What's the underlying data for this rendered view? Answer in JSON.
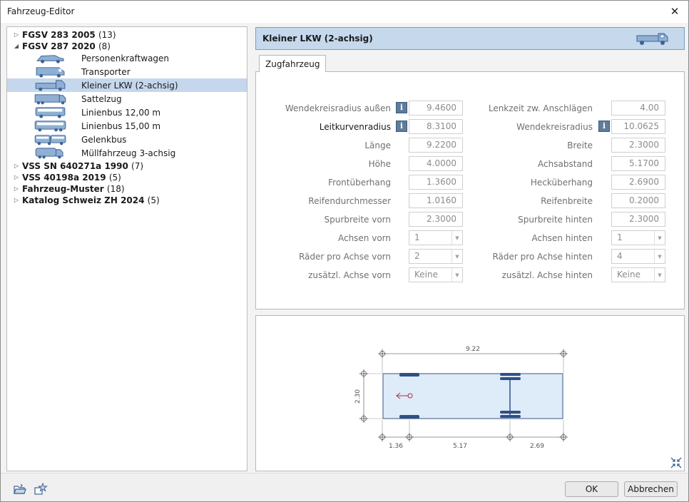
{
  "window": {
    "title": "Fahrzeug-Editor"
  },
  "tree": {
    "groups": [
      {
        "label": "FGSV 283 2005",
        "count": "(13)",
        "expanded": false
      },
      {
        "label": "FGSV 287 2020",
        "count": "(8)",
        "expanded": true
      },
      {
        "label": "VSS SN 640271a 1990",
        "count": "(7)",
        "expanded": false
      },
      {
        "label": "VSS 40198a 2019",
        "count": "(5)",
        "expanded": false
      },
      {
        "label": "Fahrzeug-Muster",
        "count": "(18)",
        "expanded": false
      },
      {
        "label": "Katalog Schweiz ZH 2024",
        "count": "(5)",
        "expanded": false
      }
    ],
    "items": [
      {
        "label": "Personenkraftwagen",
        "icon": "car-icon"
      },
      {
        "label": "Transporter",
        "icon": "van-icon"
      },
      {
        "label": "Kleiner LKW (2-achsig)",
        "icon": "truck-icon",
        "selected": true
      },
      {
        "label": "Sattelzug",
        "icon": "semitrailer-icon"
      },
      {
        "label": "Linienbus 12,00 m",
        "icon": "bus-icon"
      },
      {
        "label": "Linienbus 15,00 m",
        "icon": "long-bus-icon"
      },
      {
        "label": "Gelenkbus",
        "icon": "articulated-bus-icon"
      },
      {
        "label": "Müllfahrzeug 3-achsig",
        "icon": "garbage-truck-icon"
      }
    ]
  },
  "header": {
    "title": "Kleiner LKW (2-achsig)"
  },
  "tab": {
    "label": "Zugfahrzeug"
  },
  "left_props": [
    {
      "label": "Wendekreisradius außen",
      "value": "9.4600",
      "info": true,
      "enabled": false,
      "kind": "field"
    },
    {
      "label": "Leitkurvenradius",
      "value": "8.3100",
      "info": true,
      "enabled": true,
      "kind": "field"
    },
    {
      "label": "Länge",
      "value": "9.2200",
      "kind": "field"
    },
    {
      "label": "Höhe",
      "value": "4.0000",
      "kind": "field"
    },
    {
      "label": "Frontüberhang",
      "value": "1.3600",
      "kind": "field"
    },
    {
      "label": "Reifendurchmesser",
      "value": "1.0160",
      "kind": "field"
    },
    {
      "label": "Spurbreite vorn",
      "value": "2.3000",
      "kind": "field"
    },
    {
      "label": "Achsen vorn",
      "value": "1",
      "kind": "combo"
    },
    {
      "label": "Räder pro Achse vorn",
      "value": "2",
      "kind": "combo"
    },
    {
      "label": "zusätzl. Achse vorn",
      "value": "Keine",
      "kind": "combo"
    }
  ],
  "right_props": [
    {
      "label": "Lenkzeit zw. Anschlägen",
      "value": "4.00",
      "kind": "field"
    },
    {
      "label": "Wendekreisradius",
      "value": "10.0625",
      "info": true,
      "kind": "field"
    },
    {
      "label": "Breite",
      "value": "2.3000",
      "kind": "field"
    },
    {
      "label": "Achsabstand",
      "value": "5.1700",
      "kind": "field"
    },
    {
      "label": "Hecküberhang",
      "value": "2.6900",
      "kind": "field"
    },
    {
      "label": "Reifenbreite",
      "value": "0.2000",
      "kind": "field"
    },
    {
      "label": "Spurbreite hinten",
      "value": "2.3000",
      "kind": "field"
    },
    {
      "label": "Achsen hinten",
      "value": "1",
      "kind": "combo"
    },
    {
      "label": "Räder pro Achse hinten",
      "value": "4",
      "kind": "combo"
    },
    {
      "label": "zusätzl. Achse hinten",
      "value": "Keine",
      "kind": "combo"
    }
  ],
  "preview": {
    "length_label": "9.22",
    "width_label": "2.30",
    "front_overhang_label": "1.36",
    "wheelbase_label": "5.17",
    "rear_overhang_label": "2.69"
  },
  "buttons": {
    "ok": "OK",
    "cancel": "Abbrechen"
  },
  "colors": {
    "accent": "#c5d8ec",
    "selection": "#c4d7ec",
    "vehicle_fill": "#deebf8",
    "axle": "#2f4f86"
  }
}
